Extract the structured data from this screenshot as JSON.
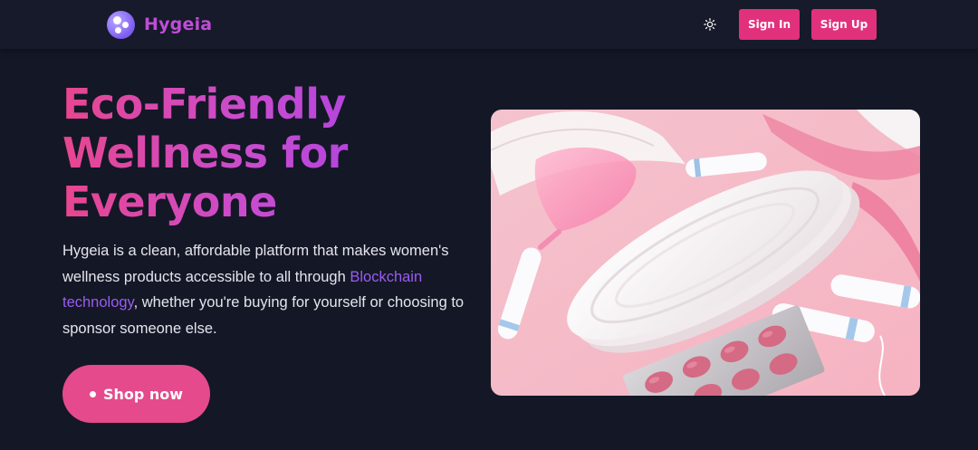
{
  "brand": {
    "name": "Hygeia",
    "logo_icon": "hygeia-logo-icon"
  },
  "header": {
    "theme_toggle_icon": "sun-icon",
    "signin_label": "Sign In",
    "signup_label": "Sign Up"
  },
  "hero": {
    "title_line1": "Eco-Friendly",
    "title_line2": "Wellness for",
    "title_line3": "Everyone",
    "desc_before": "Hygeia is a clean, affordable platform that makes women's wellness products accessible to all through ",
    "desc_highlight": "Blockchain technology",
    "desc_after": ", whether you're buying for yourself or choosing to sponsor someone else.",
    "cta_label": "Shop now"
  },
  "colors": {
    "background": "#141726",
    "accent_pink": "#e1317c",
    "accent_purple": "#9b5cf2"
  }
}
